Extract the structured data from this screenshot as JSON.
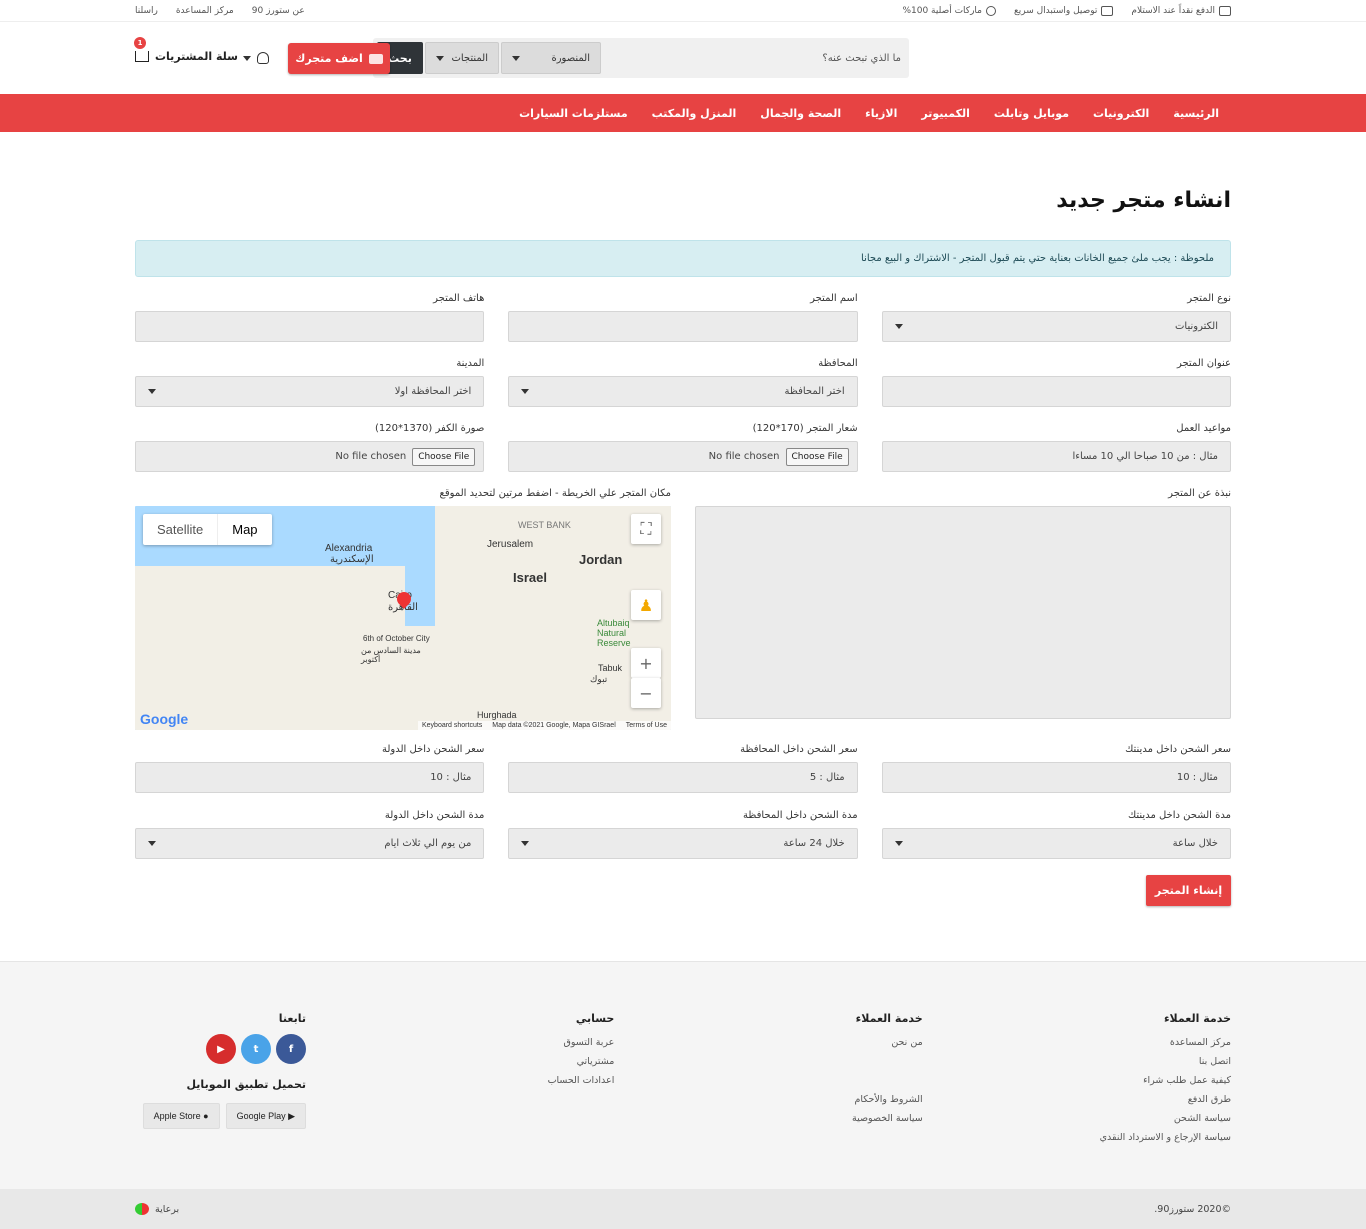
{
  "topbar": {
    "right": [
      {
        "icon": "card-icon",
        "label": "الدفع نقداً عند الاستلام"
      },
      {
        "icon": "truck-icon",
        "label": "توصيل واستبدال سريع"
      },
      {
        "icon": "check-badge-icon",
        "label": "ماركات أصلية 100%"
      }
    ],
    "left": [
      "عن ستورز 90",
      "مركز المساعدة",
      "راسلنا"
    ]
  },
  "header": {
    "search_placeholder": "ما الذي تبحث عنه؟",
    "city_select": "المنصورة",
    "category_select": "المنتجات",
    "search_button": "بحث",
    "add_store_button": "اضف متجرك",
    "cart_label": "سلة المشتريات",
    "cart_count": "1"
  },
  "nav": [
    "الرئيسية",
    "الكترونيات",
    "موبايل وتابلت",
    "الكمبيوتر",
    "الازياء",
    "الصحة والجمال",
    "المنزل والمكتب",
    "مستلزمات السيارات"
  ],
  "page": {
    "title": "انشاء متجر جديد",
    "note": "ملحوظة : يجب ملئ جميع الخانات بعناية حتي يتم قبول المتجر - الاشتراك و البيع مجانا"
  },
  "form": {
    "store_type": {
      "label": "نوع المتجر",
      "value": "الكترونيات"
    },
    "store_name": {
      "label": "اسم المتجر",
      "value": ""
    },
    "store_phone": {
      "label": "هاتف المتجر",
      "value": ""
    },
    "store_address": {
      "label": "عنوان المتجر",
      "value": ""
    },
    "governorate": {
      "label": "المحافظة",
      "value": "اختر المحافظة"
    },
    "city": {
      "label": "المدينة",
      "value": "اختر المحافظة اولا"
    },
    "work_hours": {
      "label": "مواعيد العمل",
      "placeholder": "مثال : من 10 صباحا الي 10 مساءا"
    },
    "logo": {
      "label": "شعار المتجر (170*120)",
      "button": "Choose File",
      "status": "No file chosen"
    },
    "cover": {
      "label": "صورة الكفر (1370*120)",
      "button": "Choose File",
      "status": "No file chosen"
    },
    "about": {
      "label": "نبذة عن المتجر"
    },
    "map_label": "مكان المتجر علي الخريطة - اضفط مرتين لتحديد الموقع",
    "ship_city_price": {
      "label": "سعر الشحن داخل مدينتك",
      "placeholder": "مثال : 10"
    },
    "ship_gov_price": {
      "label": "سعر الشحن داخل المحافظة",
      "placeholder": "مثال : 5"
    },
    "ship_country_price": {
      "label": "سعر الشحن داخل الدولة",
      "placeholder": "مثال : 10"
    },
    "ship_city_time": {
      "label": "مدة الشحن داخل مدينتك",
      "value": "خلال ساعة"
    },
    "ship_gov_time": {
      "label": "مدة الشحن داخل المحافظة",
      "value": "خلال 24 ساعة"
    },
    "ship_country_time": {
      "label": "مدة الشحن داخل الدولة",
      "value": "من يوم الي ثلاث ايام"
    },
    "submit": "إنشاء المتجر"
  },
  "map": {
    "tab_map": "Map",
    "tab_satellite": "Satellite",
    "labels": [
      "Alexandria",
      "الإسكندرية",
      "Cairo",
      "القاهرة",
      "6th of October City",
      "مدينة السادس من أكتوبر",
      "Jerusalem",
      "WEST BANK",
      "Israel",
      "Jordan",
      "Altubaiq Natural Reserve",
      "Tabuk",
      "تبوك",
      "Hurghada"
    ],
    "attribution": [
      "Keyboard shortcuts",
      "Map data ©2021 Google, Mapa GISrael",
      "Terms of Use"
    ],
    "logo": "Google"
  },
  "footer": {
    "col1": {
      "title": "خدمة العملاء",
      "links": [
        "مركز المساعدة",
        "اتصل بنا",
        "كيفية عمل طلب شراء",
        "طرق الدفع",
        "سياسة الشحن",
        "سياسة الإرجاع و الاسترداد النقدي"
      ]
    },
    "col2": {
      "title": "خدمة العملاء",
      "links": [
        "من نحن",
        "",
        "",
        "الشروط والأحكام",
        "سياسة الخصوصية"
      ]
    },
    "col3": {
      "title": "حسابي",
      "links": [
        "عربة التسوق",
        "مشترياتي",
        "اعدادات الحساب"
      ]
    },
    "col4": {
      "title": "تابعنا",
      "app_title": "تحميل تطبيق الموبايل",
      "google_play": "Google Play",
      "apple_store": "Apple Store"
    },
    "social_colors": {
      "facebook": "#3b5998",
      "twitter": "#4aa3e8",
      "youtube": "#d62d2d"
    }
  },
  "bottom": {
    "copyright": "©2020 ستورز90.",
    "sponsor": "برعاية"
  },
  "colors": {
    "accent": "#e74343",
    "dark": "#2f3438"
  }
}
